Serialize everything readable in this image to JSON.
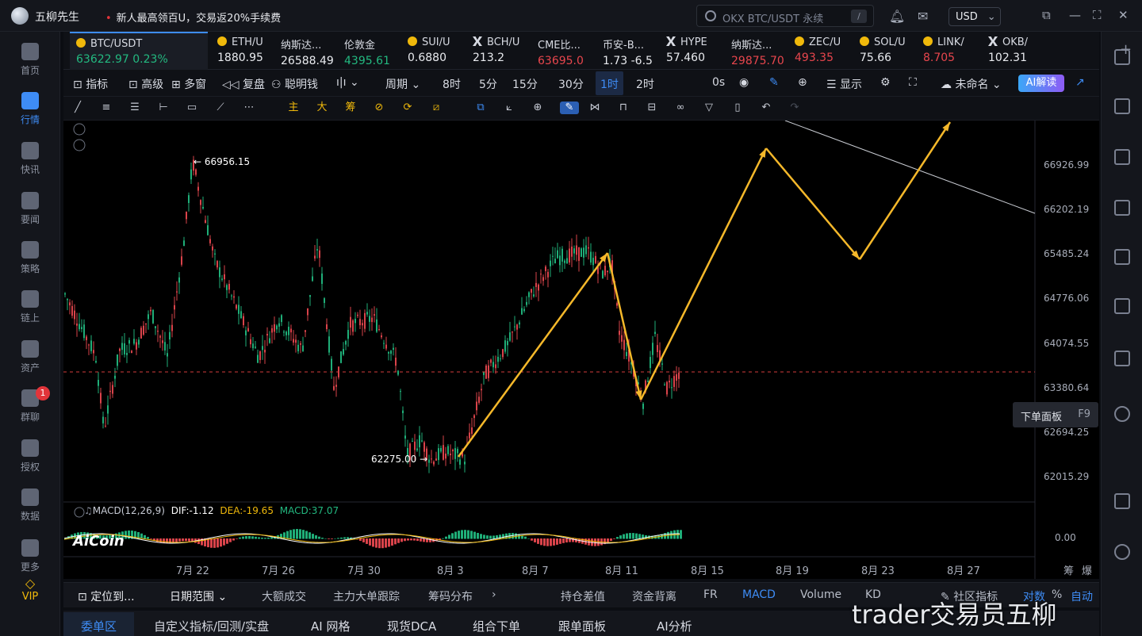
{
  "app": {
    "name": "五柳先生",
    "promo": "新人最高领百U，交易返20%手续费",
    "search_placeholder": "OKX BTC/USDT 永续",
    "search_key": "/",
    "currency": "USD"
  },
  "leftnav": [
    {
      "label": "首页",
      "icon": "home-icon"
    },
    {
      "label": "行情",
      "icon": "chart-bars-icon",
      "active": true
    },
    {
      "label": "快讯",
      "icon": "news-icon"
    },
    {
      "label": "要闻",
      "icon": "headline-icon"
    },
    {
      "label": "策略",
      "icon": "robot-icon"
    },
    {
      "label": "链上",
      "icon": "chain-icon"
    },
    {
      "label": "资产",
      "icon": "wallet-icon"
    },
    {
      "label": "群聊",
      "icon": "chat-icon",
      "badge": "1"
    },
    {
      "label": "授权",
      "icon": "key-icon"
    },
    {
      "label": "数据",
      "icon": "data-icon"
    },
    {
      "label": "更多",
      "icon": "grid-icon"
    }
  ],
  "vip": "VIP",
  "tabs": [
    {
      "name": "BTC/USDT",
      "price": "63622.97",
      "change": "0.23%",
      "active": true,
      "color": "green"
    },
    {
      "name": "ETH/U",
      "price": "1880.95",
      "color": "white"
    },
    {
      "name": "纳斯达...",
      "price": "26588.49",
      "color": "white"
    },
    {
      "name": "伦敦金",
      "price": "4395.61",
      "color": "green"
    },
    {
      "name": "SUI/U",
      "price": "0.6880",
      "color": "white"
    },
    {
      "name": "BCH/U",
      "price": "213.2",
      "color": "white"
    },
    {
      "name": "CME比...",
      "price": "63695.0",
      "color": "red"
    },
    {
      "name": "币安-B...",
      "price": "1.73 -6.5",
      "color": "white"
    },
    {
      "name": "HYPE",
      "price": "57.460",
      "color": "white"
    },
    {
      "name": "纳斯达...",
      "price": "29875.70",
      "color": "red"
    },
    {
      "name": "ZEC/U",
      "price": "493.35",
      "color": "red"
    },
    {
      "name": "SOL/U",
      "price": "75.66",
      "color": "white"
    },
    {
      "name": "LINK/",
      "price": "8.705",
      "color": "red"
    },
    {
      "name": "OKB/",
      "price": "102.31",
      "color": "white"
    }
  ],
  "toolbar1": {
    "indicators": "指标",
    "advanced": "高级",
    "multiwin": "多窗",
    "replay": "复盘",
    "smartmoney": "聪明钱",
    "period": "周期",
    "p8h": "8时",
    "p5m": "5分",
    "p15m": "15分",
    "p30m": "30分",
    "p1h": "1时",
    "p2h": "2时",
    "countdown": "0s",
    "display": "显示",
    "layout": "未命名",
    "ai": "AI解读"
  },
  "toolbar2": {
    "main": "主",
    "big": "大",
    "chip": "筹"
  },
  "chart_data": {
    "type": "candlestick",
    "symbol": "BTC/USDT",
    "x_ticks": [
      "7月 22",
      "7月 26",
      "7月 30",
      "8月 3",
      "8月 7",
      "8月 11",
      "8月 15",
      "8月 19",
      "8月 23",
      "8月 27"
    ],
    "y_ticks": [
      "66926.99",
      "66202.19",
      "65485.24",
      "64776.06",
      "64074.55",
      "63380.64",
      "62694.25",
      "62015.29"
    ],
    "high_label": "66956.15",
    "low_label": "62275.00",
    "current_price": "63622.97",
    "macd": {
      "label": "MACD(12,26,9)",
      "dif": "DIF:-1.12",
      "dea": "DEA:-19.65",
      "macd": "MACD:37.07",
      "zero": "0.00"
    },
    "overlay_note": "yellow projection arrows: rise from 62275 to ~65550, drop to ~63250, rise to ~66700, drop to ~65450, rise to ~67000"
  },
  "extras": {
    "chou": "筹",
    "bao": "爆",
    "order_panel": "下单面板",
    "order_key": "F9"
  },
  "bottombar1": [
    "定位到...",
    "日期范围",
    "大额成交",
    "主力大单跟踪",
    "筹码分布",
    "持仓差值",
    "资金背离",
    "FR",
    "MACD",
    "Volume",
    "KD",
    "社区指标",
    "对数",
    "%",
    "自动"
  ],
  "bottombar2": [
    "委单区",
    "自定义指标/回测/实盘",
    "AI 网格",
    "现货DCA",
    "组合下单",
    "跟单面板",
    "AI分析"
  ],
  "watermark": "trader交易员五柳",
  "brand": "AiCoin"
}
